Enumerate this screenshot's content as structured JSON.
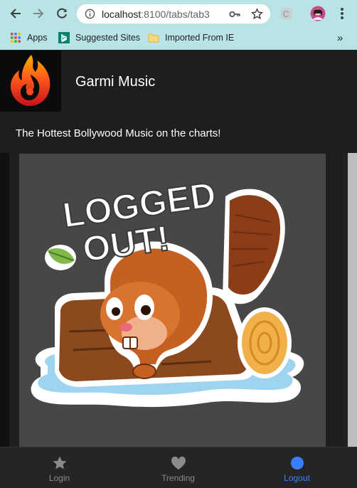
{
  "browser": {
    "url_host": "localhost",
    "url_path": ":8100/tabs/tab3",
    "bookmarks": [
      {
        "label": "Apps",
        "icon": "apps-grid-icon"
      },
      {
        "label": "Suggested Sites",
        "icon": "bing-icon"
      },
      {
        "label": "Imported From IE",
        "icon": "folder-icon"
      }
    ],
    "overflow": "»"
  },
  "app": {
    "title": "Garmi Music",
    "subtitle": "The Hottest Bollywood Music on the charts!",
    "logo_icon": "flame-logo-icon",
    "sticker": {
      "line1": "LOGGED",
      "line2": "OUT!"
    }
  },
  "tabs": [
    {
      "label": "Login",
      "icon": "star-icon",
      "color": "#8a8a8a"
    },
    {
      "label": "Trending",
      "icon": "heart-icon",
      "color": "#8a8a8a"
    },
    {
      "label": "Logout",
      "icon": "circle-icon",
      "color": "#3880ff",
      "selected": true
    }
  ],
  "colors": {
    "accent": "#3880ff",
    "chrome": "#b9e4e6",
    "background": "#1e1e1e"
  }
}
